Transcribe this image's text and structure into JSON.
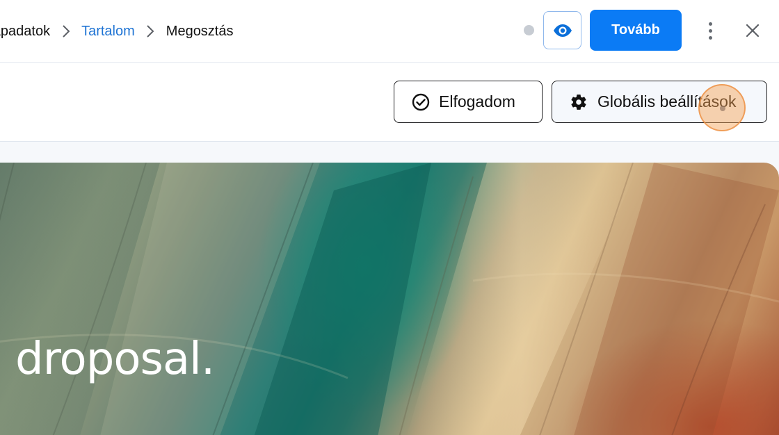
{
  "breadcrumb": {
    "items": [
      {
        "label": "Alapadatok"
      },
      {
        "label": "Tartalom"
      },
      {
        "label": "Megosztás"
      }
    ]
  },
  "topbar": {
    "preview_icon": "eye-icon",
    "next_label": "Tovább",
    "more_icon": "more-vertical-icon",
    "close_icon": "close-icon"
  },
  "toolbar": {
    "accept_label": "Elfogadom",
    "accept_icon": "check-circle-icon",
    "global_settings_label": "Globális beállítások",
    "global_settings_icon": "gear-icon"
  },
  "preview": {
    "logo_text": "droposal."
  },
  "colors": {
    "primary": "#0b7bf5",
    "link": "#1f74d4",
    "click_marker": "#f7a050"
  }
}
